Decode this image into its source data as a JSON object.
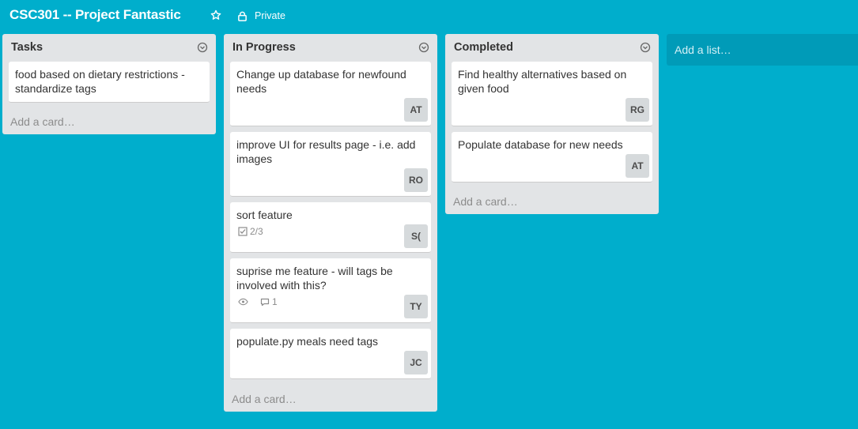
{
  "board": {
    "title": "CSC301 -- Project Fantastic",
    "visibility": "Private",
    "background_color": "#00aecc"
  },
  "lists": [
    {
      "title": "Tasks",
      "add_card_label": "Add a card…",
      "cards": [
        {
          "text": "food based on dietary restrictions - standardize tags",
          "members": []
        }
      ]
    },
    {
      "title": "In Progress",
      "add_card_label": "Add a card…",
      "cards": [
        {
          "text": "Change up database for newfound needs",
          "members": [
            "AT"
          ]
        },
        {
          "text": "improve UI for results page - i.e. add images",
          "members": [
            "RO"
          ]
        },
        {
          "text": "sort feature",
          "checklist": "2/3",
          "members": [
            "S("
          ]
        },
        {
          "text": "suprise me feature - will tags be involved with this?",
          "comments": "1",
          "watching": true,
          "members": [
            "TY"
          ]
        },
        {
          "text": "populate.py meals need tags",
          "members": [
            "JC"
          ]
        }
      ]
    },
    {
      "title": "Completed",
      "add_card_label": "Add a card…",
      "cards": [
        {
          "text": "Find healthy alternatives based on given food",
          "members": [
            "RG"
          ]
        },
        {
          "text": "Populate database for new needs",
          "members": [
            "AT"
          ]
        }
      ]
    }
  ],
  "add_list_label": "Add a list…",
  "icons": {
    "star": "star-icon",
    "lock": "lock-icon",
    "list_menu": "chevron-down-circle-icon",
    "checklist": "checkbox-icon",
    "watch": "eye-icon",
    "comment": "comment-icon"
  }
}
